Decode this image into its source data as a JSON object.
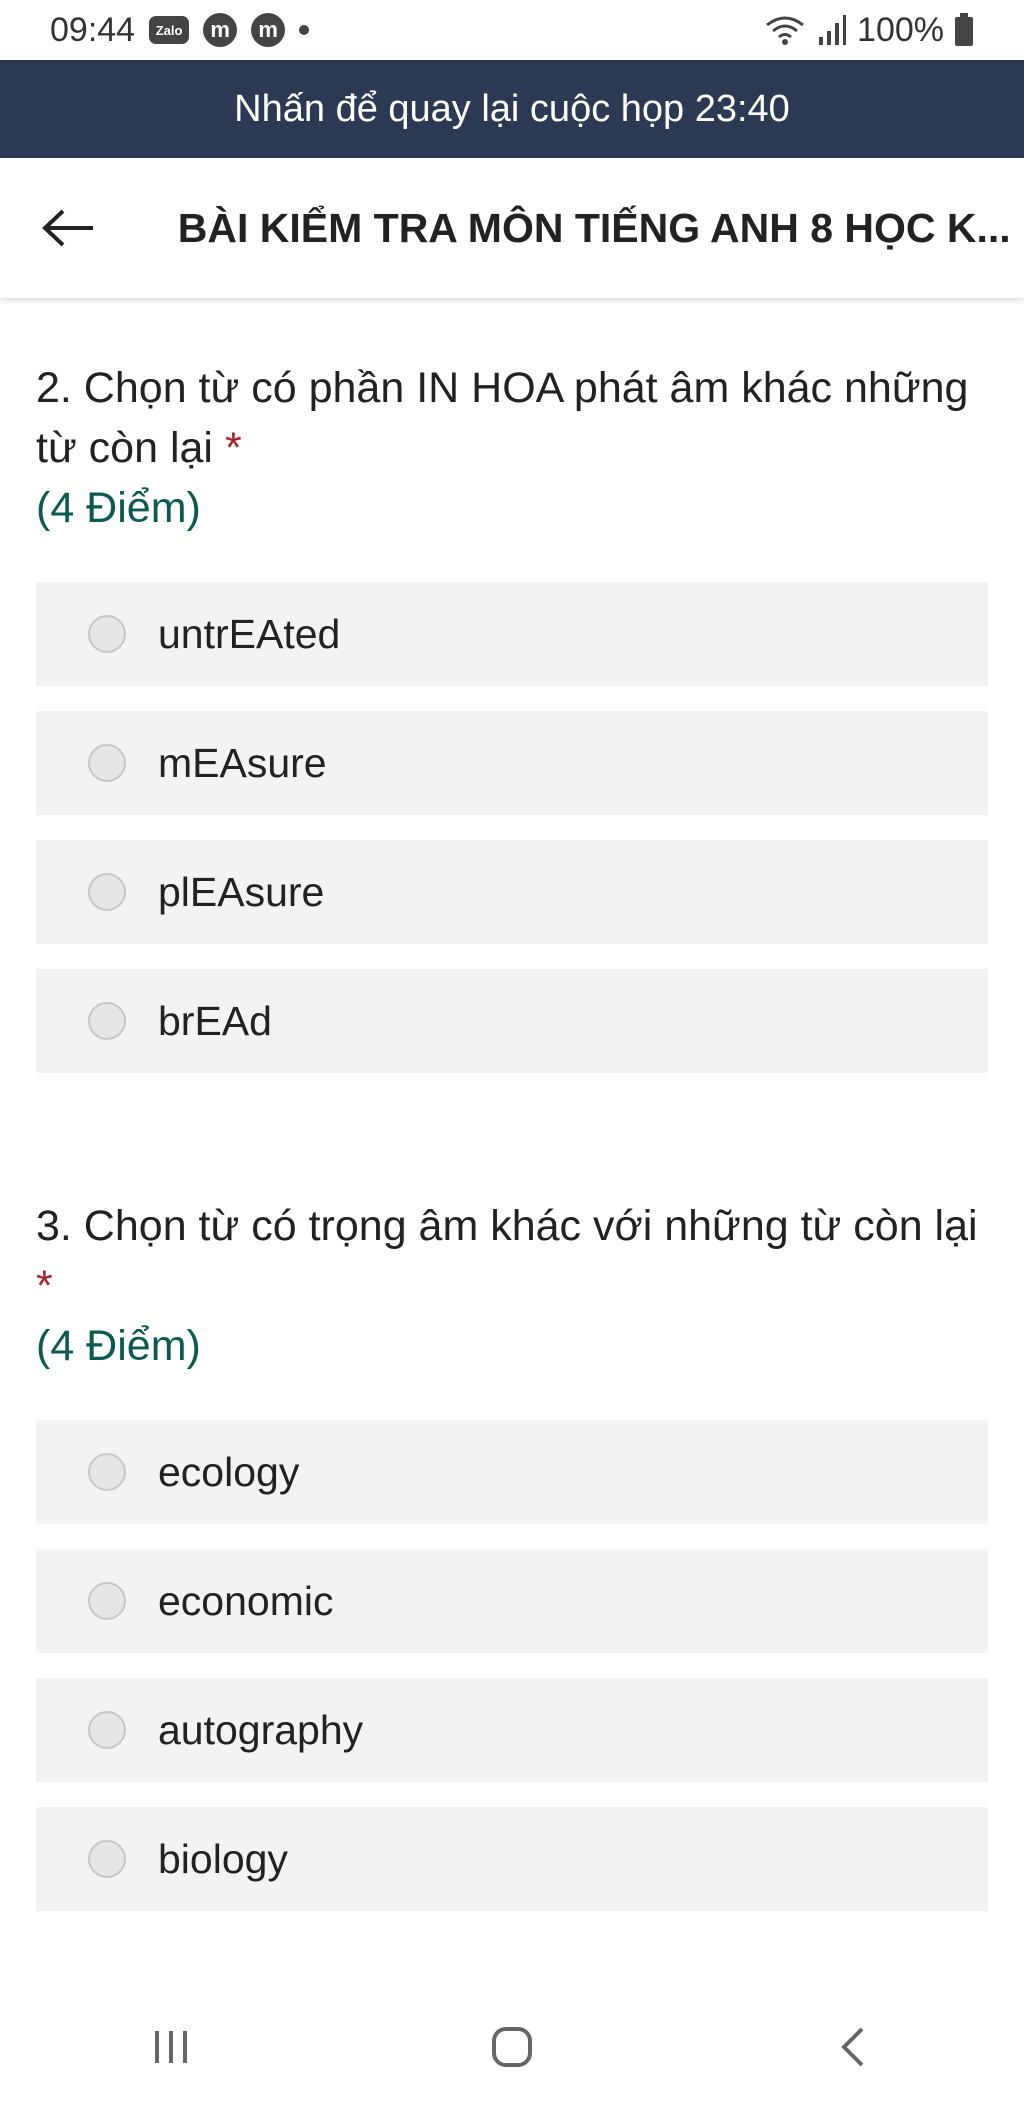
{
  "status_bar": {
    "time": "09:44",
    "notif_zalo": "Zalo",
    "notif_m1": "m",
    "notif_m2": "m",
    "battery": "100%",
    "icons": [
      "zalo-icon",
      "messenger-icon",
      "messenger-icon",
      "dot-icon",
      "wifi-icon",
      "signal-icon",
      "battery-icon"
    ]
  },
  "banner": {
    "text": "Nhấn để quay lại cuộc họp 23:40"
  },
  "header": {
    "title": "BÀI KIỂM TRA MÔN TIẾNG ANH 8 HỌC K..."
  },
  "questions": [
    {
      "text": "2. Chọn từ có phần IN HOA phát âm khác những từ còn lại",
      "required_mark": "*",
      "points": "(4 Điểm)",
      "options": [
        "untrEAted",
        "mEAsure",
        "plEAsure",
        "brEAd"
      ]
    },
    {
      "text": "3. Chọn từ có trọng âm khác với những từ còn lại",
      "required_mark": "*",
      "points": "(4 Điểm)",
      "options": [
        "ecology",
        "economic",
        "autography",
        "biology"
      ]
    }
  ],
  "colors": {
    "banner_bg": "#2b3a52",
    "points_text": "#0b5a4f",
    "required_mark": "#a4262c",
    "option_bg": "#f3f3f3"
  }
}
